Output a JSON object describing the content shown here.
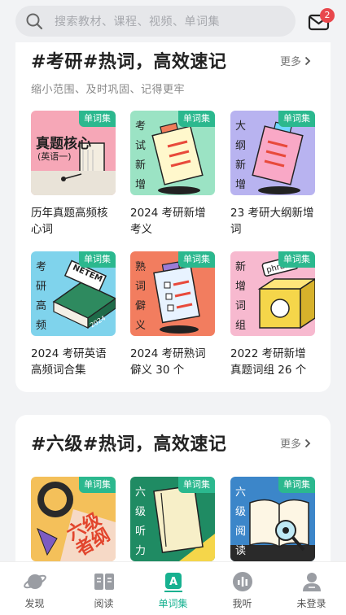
{
  "search": {
    "placeholder": "搜索教材、课程、视频、单词集"
  },
  "notifications": {
    "badge": "2"
  },
  "section1": {
    "title": "#考研#热词，高效速记",
    "more": "更多",
    "subtitle": "缩小范围、及时巩固、记得更牢",
    "tag": "单词集",
    "items": [
      {
        "name": "历年真题高频核心词",
        "cover_main": "真题核心",
        "cover_sub": "(英语一)"
      },
      {
        "name": "2024 考研新增考义",
        "cover_vertical": [
          "考",
          "试",
          "新",
          "增"
        ]
      },
      {
        "name": "23 考研大纲新增词",
        "cover_vertical": [
          "大",
          "纲",
          "新",
          "增"
        ]
      },
      {
        "name": "2024 考研英语高频词合集",
        "cover_vertical": [
          "考",
          "研",
          "高",
          "频"
        ],
        "cover_book": "NETEM",
        "cover_book2": "2024"
      },
      {
        "name": "2024 考研熟词僻义 30 个",
        "cover_vertical": [
          "熟",
          "词",
          "僻",
          "义"
        ]
      },
      {
        "name": "2022 考研新增真题词组 26 个",
        "cover_vertical": [
          "新",
          "增",
          "词",
          "组"
        ],
        "cover_word": "phrase"
      }
    ]
  },
  "section2": {
    "title": "#六级#热词，高效速记",
    "more": "更多",
    "tag": "单词集",
    "items": [
      {
        "cover_text": "六级 者纲"
      },
      {
        "cover_vertical": [
          "六",
          "级",
          "听",
          "力"
        ]
      },
      {
        "cover_vertical": [
          "六",
          "级",
          "阅",
          "读"
        ]
      }
    ]
  },
  "nav": [
    {
      "label": "发现",
      "icon": "planet-icon",
      "active": false
    },
    {
      "label": "阅读",
      "icon": "book-icon",
      "active": false
    },
    {
      "label": "单词集",
      "icon": "word-set-icon",
      "active": true
    },
    {
      "label": "我听",
      "icon": "listen-icon",
      "active": false
    },
    {
      "label": "未登录",
      "icon": "user-icon",
      "active": false
    }
  ],
  "colors": {
    "accent": "#17b190",
    "tag": "#2bb88e",
    "badge": "#e8474c"
  }
}
